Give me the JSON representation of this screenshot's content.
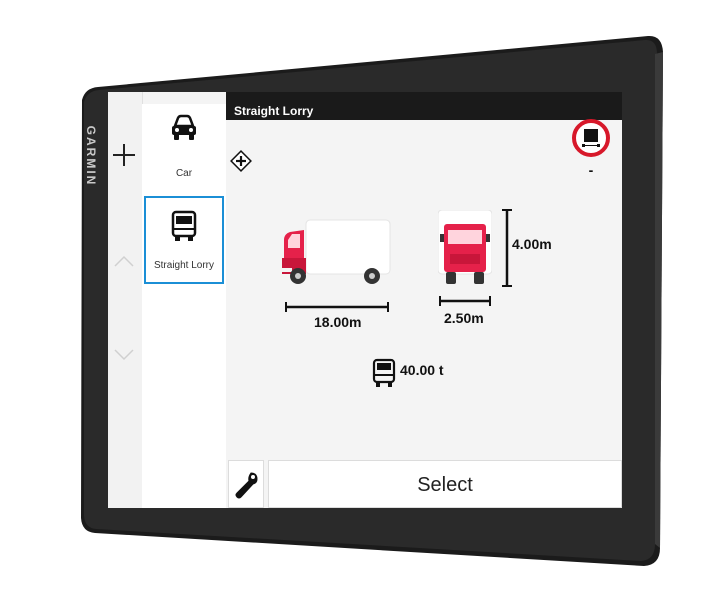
{
  "device": {
    "brand": "GARMIN"
  },
  "header": {
    "title": "Straight Lorry"
  },
  "sidebar": {
    "add_icon": "plus-icon",
    "scroll_up_icon": "chevron-up-icon",
    "scroll_down_icon": "chevron-down-icon",
    "items": [
      {
        "label": "Car",
        "icon": "car-icon",
        "selected": false
      },
      {
        "label": "Straight Lorry",
        "icon": "lorry-icon",
        "selected": true
      }
    ]
  },
  "main": {
    "hazmat_icon": "hazmat-plus-icon",
    "restriction_sign_label": "-",
    "dimensions": {
      "length": "18.00m",
      "width": "2.50m",
      "height": "4.00m"
    },
    "weight": "40.00 t"
  },
  "footer": {
    "settings_icon": "wrench-icon",
    "select_label": "Select"
  },
  "colors": {
    "accent": "#1b8fd6",
    "truck_red": "#e5214a",
    "sign_red": "#d7182a"
  }
}
